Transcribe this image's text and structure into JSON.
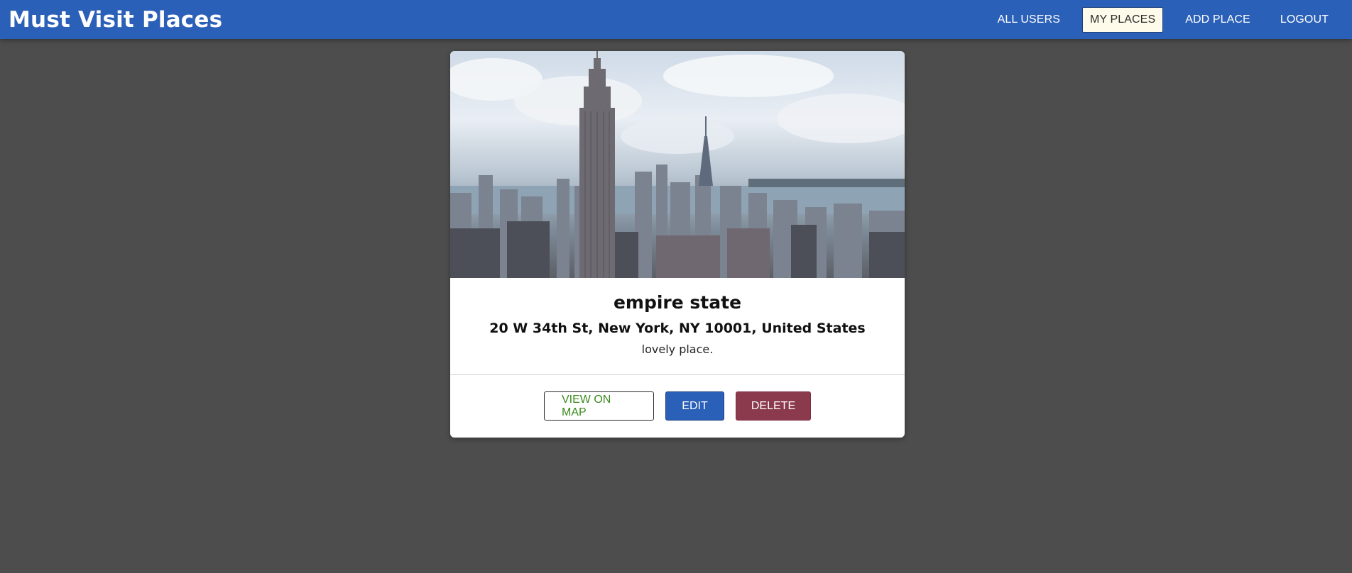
{
  "header": {
    "brand": "Must Visit Places",
    "nav": [
      {
        "label": "ALL USERS"
      },
      {
        "label": "MY PLACES",
        "active": true
      },
      {
        "label": "ADD PLACE"
      },
      {
        "label": "LOGOUT"
      }
    ]
  },
  "place": {
    "title": "empire state",
    "address": "20 W 34th St, New York, NY 10001, United States",
    "description": "lovely place.",
    "image_icon": "city-skyline-photo"
  },
  "actions": {
    "view_on_map": "VIEW ON MAP",
    "edit": "EDIT",
    "delete": "DELETE"
  },
  "colors": {
    "header_bg": "#2b60b8",
    "page_bg": "#4d4d4d",
    "edit_bg": "#2b60b8",
    "delete_bg": "#8b3a4d",
    "map_text": "#3a8a1e"
  }
}
